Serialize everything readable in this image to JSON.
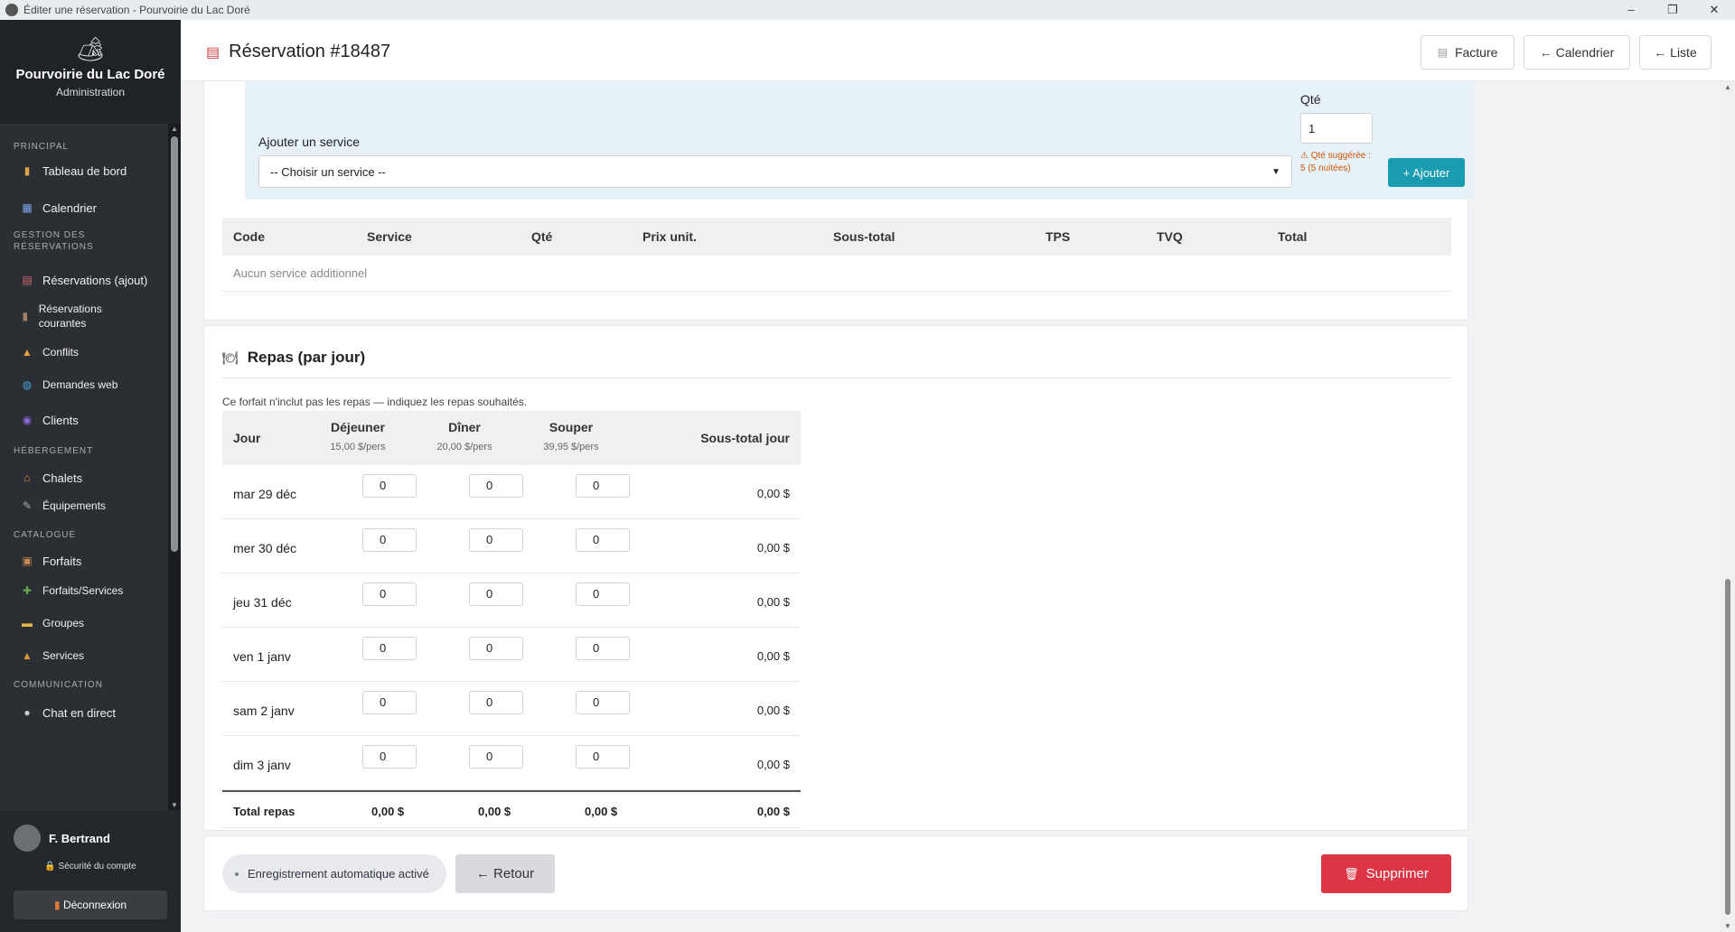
{
  "window": {
    "title": "Éditer une réservation - Pourvoirie du Lac Doré",
    "controls": [
      "–",
      "❐",
      "✕"
    ]
  },
  "brand": {
    "logo": "🏕",
    "name": "Pourvoirie du Lac Doré",
    "subtitle": "Administration"
  },
  "nav": {
    "principal": "PRINCIPAL",
    "dashboard": "Tableau de bord",
    "calendar": "Calendrier",
    "gestion": "GESTION DES RÉSERVATIONS",
    "reservations_add": "Réservations (ajout)",
    "reservations_current": "Réservations courantes",
    "conflicts": "Conflits",
    "web_requests": "Demandes web",
    "clients": "Clients",
    "hebergement": "HÉBERGEMENT",
    "chalets": "Chalets",
    "equipements": "Équipements",
    "catalogue": "CATALOGUE",
    "forfaits": "Forfaits",
    "forfaits_services": "Forfaits/Services",
    "groupes": "Groupes",
    "services": "Services",
    "communication": "COMMUNICATION",
    "chat": "Chat en direct"
  },
  "user": {
    "name": "F. Bertrand",
    "security": "Sécurité du compte",
    "logout": "Déconnexion"
  },
  "header": {
    "title": "Réservation #18487",
    "invoice": "Facture",
    "calendar": "← Calendrier",
    "list": "← Liste"
  },
  "add_service": {
    "label": "Ajouter un service",
    "select_value": "-- Choisir un service --",
    "qty_label": "Qté",
    "qty_value": "1",
    "qty_warning": "Qté suggérée : 5 (5 nuitées)",
    "add_button": "+ Ajouter"
  },
  "services_table": {
    "columns": [
      "Code",
      "Service",
      "Qté",
      "Prix unit.",
      "Sous-total",
      "TPS",
      "TVQ",
      "Total"
    ],
    "empty": "Aucun service additionnel"
  },
  "meals": {
    "title": "Repas (par jour)",
    "note": "Ce forfait n'inclut pas les repas — indiquez les repas souhaités.",
    "col_day": "Jour",
    "col_breakfast": "Déjeuner",
    "price_breakfast": "15,00 $/pers",
    "col_lunch": "Dîner",
    "price_lunch": "20,00 $/pers",
    "col_dinner": "Souper",
    "price_dinner": "39,95 $/pers",
    "col_subtotal": "Sous-total jour",
    "rows": [
      {
        "day": "mar 29 déc",
        "b": "0",
        "l": "0",
        "d": "0",
        "subtotal": "0,00 $"
      },
      {
        "day": "mer 30 déc",
        "b": "0",
        "l": "0",
        "d": "0",
        "subtotal": "0,00 $"
      },
      {
        "day": "jeu 31 déc",
        "b": "0",
        "l": "0",
        "d": "0",
        "subtotal": "0,00 $"
      },
      {
        "day": "ven 1 janv",
        "b": "0",
        "l": "0",
        "d": "0",
        "subtotal": "0,00 $"
      },
      {
        "day": "sam 2 janv",
        "b": "0",
        "l": "0",
        "d": "0",
        "subtotal": "0,00 $"
      },
      {
        "day": "dim 3 janv",
        "b": "0",
        "l": "0",
        "d": "0",
        "subtotal": "0,00 $"
      }
    ],
    "total_label": "Total repas",
    "total_b": "0,00 $",
    "total_l": "0,00 $",
    "total_d": "0,00 $",
    "total_all": "0,00 $"
  },
  "footer": {
    "autosave": "Enregistrement automatique activé",
    "back": "← Retour",
    "delete": "Supprimer"
  }
}
